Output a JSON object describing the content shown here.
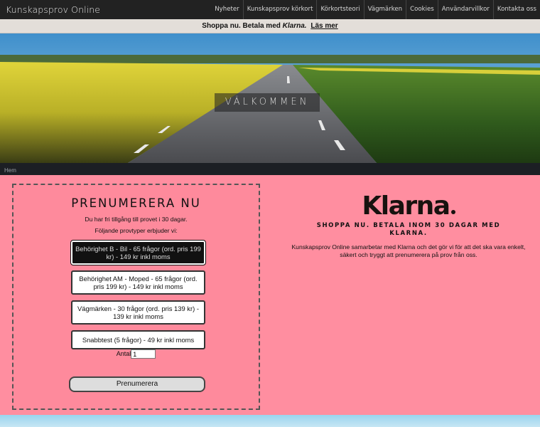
{
  "brand": "Kunskapsprov Online",
  "nav": [
    "Nyheter",
    "Kunskapsprov körkort",
    "Körkortsteori",
    "Vägmärken",
    "Cookies",
    "Användarvillkor",
    "Kontakta oss"
  ],
  "klarna_bar": {
    "text": "Shoppa nu. Betala med",
    "brand": "Klarna.",
    "link": "Läs mer"
  },
  "hero": {
    "title": "VÄLKOMMEN"
  },
  "breadcrumb": "Hem",
  "subscribe": {
    "title": "PRENUMERERA NU",
    "trial": "Du har fri tillgång till provet i 30 dagar.",
    "intro": "Följande provtyper erbjuder vi:",
    "options": [
      "Behörighet B - Bil - 65 frågor (ord. pris 199 kr) - 149 kr inkl moms",
      "Behörighet AM - Moped - 65 frågor (ord. pris 199 kr) - 149 kr inkl moms",
      "Vägmärken - 30 frågor (ord. pris 139 kr) - 139 kr inkl moms",
      "Snabbtest (5 frågor) - 49 kr inkl moms"
    ],
    "quantity_label": "Antal",
    "quantity_value": "1",
    "button": "Prenumerera"
  },
  "klarna_panel": {
    "logo": "Klarna",
    "tagline": "SHOPPA NU. BETALA INOM 30 DAGAR MED KLARNA.",
    "description": "Kunskapsprov Online samarbetar med Klarna och det gör vi för att det ska vara enkelt, säkert och tryggt att prenumerera på prov från oss."
  },
  "colors": {
    "accent": "#ff8ea0",
    "nav_bg": "#222222",
    "klarna_bar_bg": "#e3ded9"
  }
}
